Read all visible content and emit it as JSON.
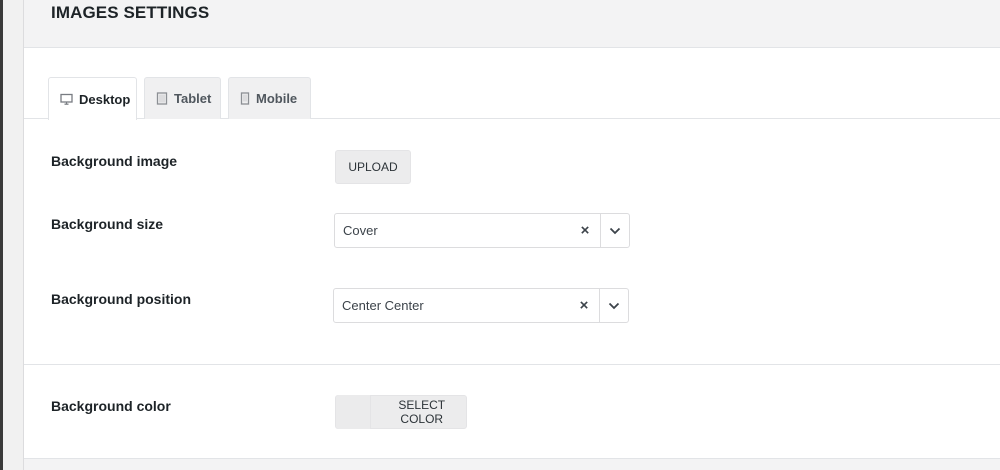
{
  "panel": {
    "title": "IMAGES SETTINGS"
  },
  "tabs": [
    {
      "label": "Desktop",
      "icon": "desktop-icon",
      "active": true
    },
    {
      "label": "Tablet",
      "icon": "tablet-icon",
      "active": false
    },
    {
      "label": "Mobile",
      "icon": "mobile-icon",
      "active": false
    }
  ],
  "fields": {
    "background_image": {
      "label": "Background image",
      "button": "UPLOAD"
    },
    "background_size": {
      "label": "Background size",
      "value": "Cover",
      "clear": "×"
    },
    "background_position": {
      "label": "Background position",
      "value": "Center Center",
      "clear": "×"
    },
    "background_color": {
      "label": "Background color",
      "button": "SELECT COLOR"
    }
  },
  "colors": {
    "header_bg": "#f3f3f4",
    "button_bg": "#ececed",
    "border": "#dcdcde"
  }
}
